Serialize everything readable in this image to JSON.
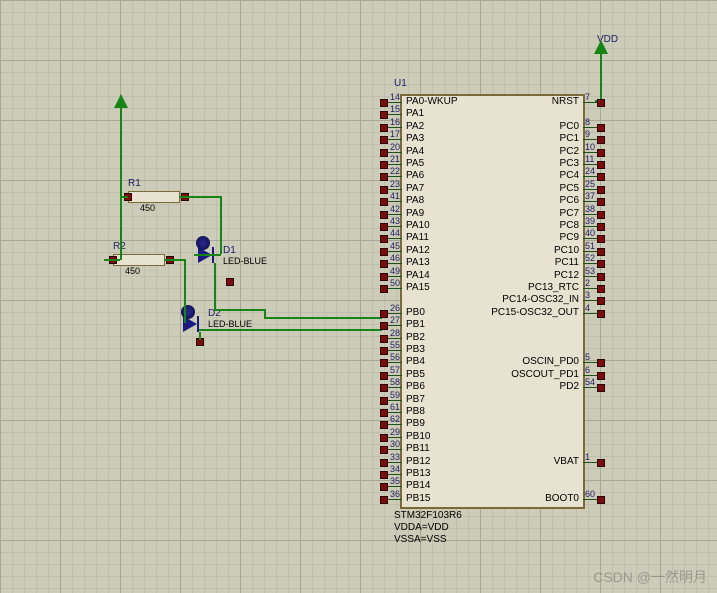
{
  "power": {
    "vdd": "VDD"
  },
  "u1": {
    "ref": "U1",
    "part": "STM32F103R6",
    "vdda": "VDDA=VDD",
    "vssa": "VSSA=VSS",
    "left_pins": [
      {
        "num": "14",
        "name": "PA0-WKUP"
      },
      {
        "num": "15",
        "name": "PA1"
      },
      {
        "num": "16",
        "name": "PA2"
      },
      {
        "num": "17",
        "name": "PA3"
      },
      {
        "num": "20",
        "name": "PA4"
      },
      {
        "num": "21",
        "name": "PA5"
      },
      {
        "num": "22",
        "name": "PA6"
      },
      {
        "num": "23",
        "name": "PA7"
      },
      {
        "num": "41",
        "name": "PA8"
      },
      {
        "num": "42",
        "name": "PA9"
      },
      {
        "num": "43",
        "name": "PA10"
      },
      {
        "num": "44",
        "name": "PA11"
      },
      {
        "num": "45",
        "name": "PA12"
      },
      {
        "num": "46",
        "name": "PA13"
      },
      {
        "num": "49",
        "name": "PA14"
      },
      {
        "num": "50",
        "name": "PA15"
      },
      {
        "num": "",
        "name": ""
      },
      {
        "num": "26",
        "name": "PB0"
      },
      {
        "num": "27",
        "name": "PB1"
      },
      {
        "num": "28",
        "name": "PB2"
      },
      {
        "num": "55",
        "name": "PB3"
      },
      {
        "num": "56",
        "name": "PB4"
      },
      {
        "num": "57",
        "name": "PB5"
      },
      {
        "num": "58",
        "name": "PB6"
      },
      {
        "num": "59",
        "name": "PB7"
      },
      {
        "num": "61",
        "name": "PB8"
      },
      {
        "num": "62",
        "name": "PB9"
      },
      {
        "num": "29",
        "name": "PB10"
      },
      {
        "num": "30",
        "name": "PB11"
      },
      {
        "num": "33",
        "name": "PB12"
      },
      {
        "num": "34",
        "name": "PB13"
      },
      {
        "num": "35",
        "name": "PB14"
      },
      {
        "num": "36",
        "name": "PB15"
      }
    ],
    "right_pins": [
      {
        "num": "7",
        "name": "NRST",
        "row": 0
      },
      {
        "num": "8",
        "name": "PC0",
        "row": 2
      },
      {
        "num": "9",
        "name": "PC1",
        "row": 3
      },
      {
        "num": "10",
        "name": "PC2",
        "row": 4
      },
      {
        "num": "11",
        "name": "PC3",
        "row": 5
      },
      {
        "num": "24",
        "name": "PC4",
        "row": 6
      },
      {
        "num": "25",
        "name": "PC5",
        "row": 7
      },
      {
        "num": "37",
        "name": "PC6",
        "row": 8
      },
      {
        "num": "38",
        "name": "PC7",
        "row": 9
      },
      {
        "num": "39",
        "name": "PC8",
        "row": 10
      },
      {
        "num": "40",
        "name": "PC9",
        "row": 11
      },
      {
        "num": "51",
        "name": "PC10",
        "row": 12
      },
      {
        "num": "52",
        "name": "PC11",
        "row": 13
      },
      {
        "num": "53",
        "name": "PC12",
        "row": 14
      },
      {
        "num": "2",
        "name": "PC13_RTC",
        "row": 15
      },
      {
        "num": "3",
        "name": "PC14-OSC32_IN",
        "row": 16
      },
      {
        "num": "4",
        "name": "PC15-OSC32_OUT",
        "row": 17
      },
      {
        "num": "5",
        "name": "OSCIN_PD0",
        "row": 21
      },
      {
        "num": "6",
        "name": "OSCOUT_PD1",
        "row": 22
      },
      {
        "num": "54",
        "name": "PD2",
        "row": 23
      },
      {
        "num": "1",
        "name": "VBAT",
        "row": 29
      },
      {
        "num": "60",
        "name": "BOOT0",
        "row": 32
      }
    ]
  },
  "r1": {
    "ref": "R1",
    "val": "450"
  },
  "r2": {
    "ref": "R2",
    "val": "450"
  },
  "d1": {
    "ref": "D1",
    "val": "LED-BLUE"
  },
  "d2": {
    "ref": "D2",
    "val": "LED-BLUE"
  },
  "watermark": "CSDN @一然明月",
  "chart_data": {
    "type": "schematic",
    "components": [
      {
        "ref": "U1",
        "part": "STM32F103R6",
        "nets": {
          "PB0": "D1 cathode",
          "PB1": "D2 cathode",
          "NRST": "VDD"
        }
      },
      {
        "ref": "R1",
        "value": 450,
        "net_a": "VDD",
        "net_b": "D1 anode"
      },
      {
        "ref": "R2",
        "value": 450,
        "net_a": "VDD",
        "net_b": "D2 anode"
      },
      {
        "ref": "D1",
        "part": "LED-BLUE",
        "anode": "R1",
        "cathode": "U1.PB0"
      },
      {
        "ref": "D2",
        "part": "LED-BLUE",
        "anode": "R2",
        "cathode": "U1.PB1"
      },
      {
        "ref": "VDD_arrow",
        "nets": [
          "U1.NRST"
        ]
      },
      {
        "ref": "VDD_arrow2",
        "nets": [
          "R1",
          "R2"
        ]
      }
    ]
  }
}
